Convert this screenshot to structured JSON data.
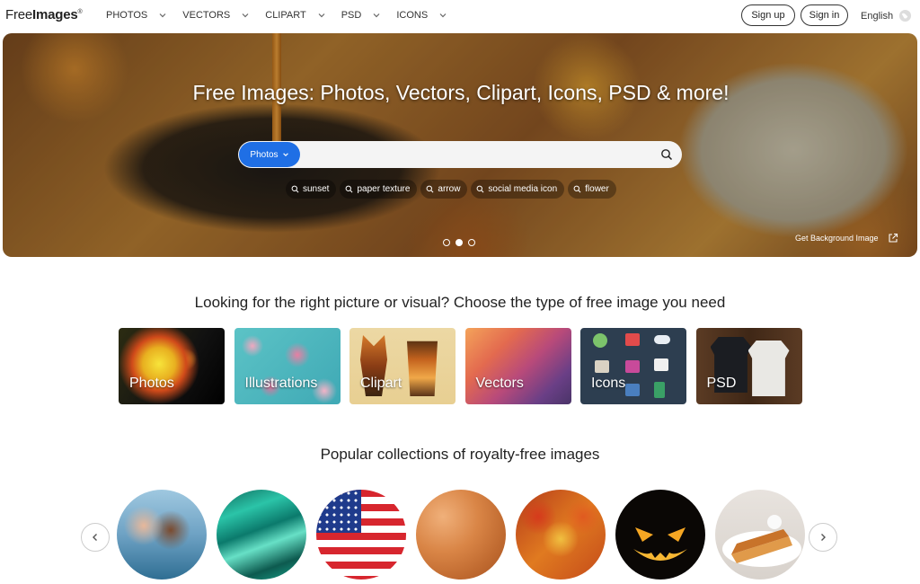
{
  "logo": {
    "part1": "Free",
    "part2": "Images",
    "mark": "®"
  },
  "nav": [
    {
      "label": "PHOTOS"
    },
    {
      "label": "VECTORS"
    },
    {
      "label": "CLIPART"
    },
    {
      "label": "PSD"
    },
    {
      "label": "ICONS"
    }
  ],
  "auth": {
    "signup": "Sign up",
    "signin": "Sign in"
  },
  "language": {
    "label": "English",
    "icon": "globe-icon"
  },
  "hero": {
    "title": "Free Images: Photos, Vectors, Clipart, Icons, PSD & more!",
    "search": {
      "type_label": "Photos",
      "value": "",
      "placeholder": "",
      "icon": "search-icon"
    },
    "tags": [
      "sunset",
      "paper texture",
      "arrow",
      "social media icon",
      "flower"
    ],
    "slides": {
      "count": 3,
      "active": 2
    },
    "get_background": "Get Background Image"
  },
  "types_section": {
    "title": "Looking for the right picture or visual? Choose the type of free image you need",
    "cards": [
      {
        "label": "Photos"
      },
      {
        "label": "Illustrations"
      },
      {
        "label": "Clipart"
      },
      {
        "label": "Vectors"
      },
      {
        "label": "Icons"
      },
      {
        "label": "PSD"
      }
    ]
  },
  "collections_section": {
    "title": "Popular collections of royalty-free images",
    "count": 7
  },
  "colors": {
    "accent": "#1f6fe5",
    "text": "#222222"
  }
}
